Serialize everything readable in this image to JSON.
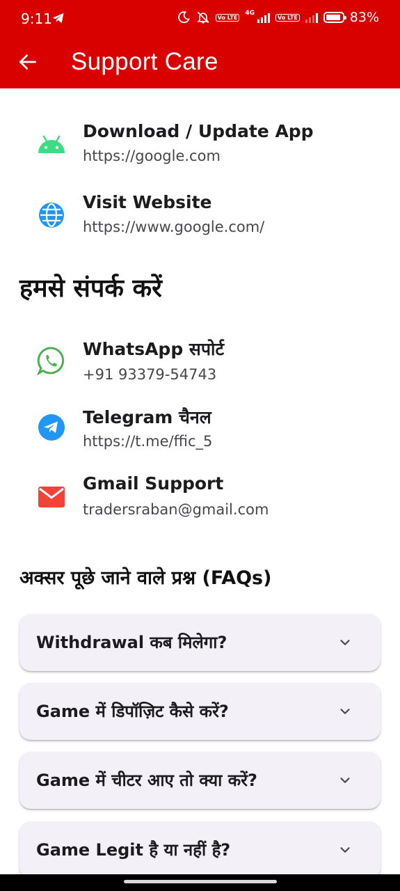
{
  "status_bar": {
    "time": "9:11",
    "volte_label": "Vo LTE",
    "network_label": "4G",
    "battery": "83%"
  },
  "app_bar": {
    "title": "Support Care",
    "color": "#d90000"
  },
  "links": [
    {
      "title": "Download / Update App",
      "subtitle": "https://google.com",
      "icon": "android-icon"
    },
    {
      "title": "Visit Website",
      "subtitle": "https://www.google.com/",
      "icon": "globe-icon"
    }
  ],
  "contact_heading": "हमसे संपर्क करें",
  "contacts": [
    {
      "title": "WhatsApp सपोर्ट",
      "subtitle": "+91 93379-54743",
      "icon": "whatsapp-icon"
    },
    {
      "title": "Telegram चैनल",
      "subtitle": "https://t.me/ffic_5",
      "icon": "telegram-icon"
    },
    {
      "title": "Gmail Support",
      "subtitle": "tradersraban@gmail.com",
      "icon": "gmail-icon"
    }
  ],
  "faq_heading": "अक्सर पूछे जाने वाले प्रश्न (FAQs)",
  "faqs": [
    {
      "question": "Withdrawal कब मिलेगा?"
    },
    {
      "question": "Game में डिपॉज़िट कैसे करें?"
    },
    {
      "question": "Game में चीटर आए तो क्या करें?"
    },
    {
      "question": "Game Legit है या नहीं है?"
    }
  ],
  "colors": {
    "android": "#3ddc84",
    "globe": "#2196f3",
    "whatsapp": "#4caf50",
    "telegram": "#2196f3",
    "gmail": "#f44336"
  }
}
